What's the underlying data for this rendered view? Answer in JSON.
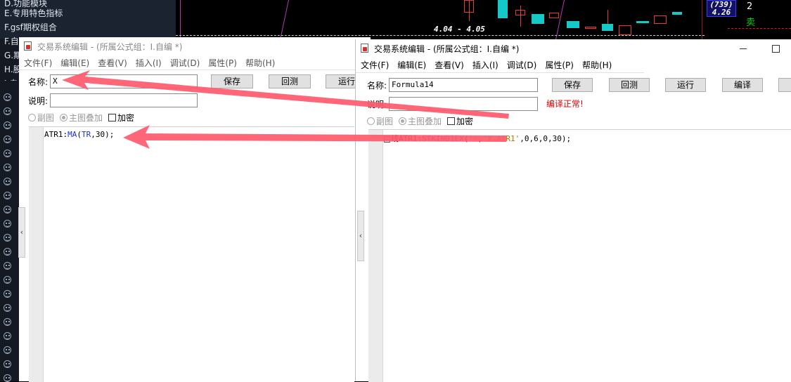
{
  "background_list": {
    "items": [
      {
        "label": "E.专用特色指标"
      },
      {
        "label": "F.gsf期权组合"
      },
      {
        "label": "F.自"
      },
      {
        "label": "G.期"
      },
      {
        "label": "H.股"
      },
      {
        "label": "I.自"
      }
    ]
  },
  "chart": {
    "range_label": "4.04 - 4.05",
    "price_box_top": "(739)",
    "price_box_value": "4.26",
    "side_number": "2",
    "side_action": "卖"
  },
  "left_window": {
    "title": "交易系统编辑 - (所属公式组：I.自编 *)",
    "menu": [
      "文件(F)",
      "编辑(E)",
      "查看(V)",
      "插入(I)",
      "调试(D)",
      "属性(P)",
      "帮助(H)"
    ],
    "name_label": "名称:",
    "name_value": "X",
    "desc_label": "说明:",
    "desc_value": "",
    "buttons": {
      "save": "保存",
      "backtest": "回测",
      "run": "运行"
    },
    "options": {
      "sub": "副图",
      "main": "主图叠加",
      "encrypt": "加密"
    },
    "code": {
      "var": "ATR1",
      "colon": ":",
      "func": "MA",
      "open": "(",
      "arg1": "TR",
      "rest": ",30);"
    }
  },
  "right_window": {
    "title": "交易系统编辑 - (所属公式组：I.自编 *)",
    "menu": [
      "文件(F)",
      "编辑(E)",
      "查看(V)",
      "插入(I)",
      "调试(D)",
      "属性(P)",
      "帮助(H)"
    ],
    "name_label": "名称:",
    "name_value": "Formula14",
    "desc_label": "说明:",
    "desc_value": "",
    "status": "编译正常!",
    "buttons": {
      "save": "保存",
      "backtest": "回测",
      "run": "运行",
      "compile": "编译"
    },
    "options": {
      "sub": "副图",
      "main": "主图叠加",
      "encrypt": "加密"
    },
    "code": {
      "prefix": "线ATR1:",
      "func": "STKINDIEX",
      "open": "(",
      "str1": "''",
      "comma": ",",
      "str2": "'X.ATR1'",
      "rest": ",0,6,0,30);"
    }
  },
  "colors": {
    "arrow": "#ff5a6e",
    "accent_red": "#e00000",
    "keyword": "#1a33cc"
  }
}
